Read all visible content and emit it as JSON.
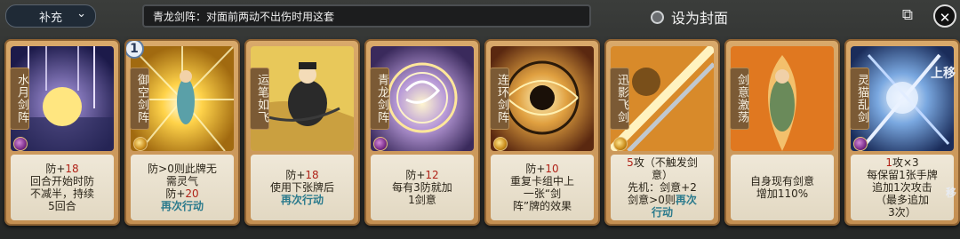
{
  "topbar": {
    "dropdown_label": "补充",
    "deck_name": "青龙剑阵：对面前两动不出伤时用这套",
    "cover_label": "设为封面"
  },
  "cards": [
    {
      "title": "水月剑阵",
      "gem": "purple",
      "lines": [
        {
          "t": "防+",
          "n": "18"
        },
        {
          "t": "回合开始时防"
        },
        {
          "t": "不减半，持续"
        },
        {
          "t": "5回合"
        }
      ]
    },
    {
      "title": "御空剑阵",
      "gem": "gold",
      "cost": "1",
      "lines": [
        {
          "t": "防>0则此牌无"
        },
        {
          "t": "需灵气"
        },
        {
          "t": "防+",
          "n": "20"
        },
        {
          "g": "再次行动"
        }
      ]
    },
    {
      "title": "运笔如飞",
      "gem": "none",
      "lines": [
        {
          "t": "防+",
          "n": "18"
        },
        {
          "t": "使用下张牌后"
        },
        {
          "g": "再次行动"
        }
      ]
    },
    {
      "title": "青龙剑阵",
      "gem": "purple",
      "lines": [
        {
          "t": "防+",
          "n": "12"
        },
        {
          "t": "每有3防就加"
        },
        {
          "t": "1剑意"
        }
      ]
    },
    {
      "title": "连环剑阵",
      "gem": "gold",
      "lines": [
        {
          "t": "防+",
          "n": "10"
        },
        {
          "t": "重复卡组中上"
        },
        {
          "t": "一张“剑"
        },
        {
          "t": "阵”牌的效果"
        }
      ]
    },
    {
      "title": "迅影飞剑",
      "gem": "gold",
      "lines": [
        {
          "n": "5",
          "t": "攻（不触发剑"
        },
        {
          "t": "意）"
        },
        {
          "t": "先机：剑意+2"
        },
        {
          "t": "剑意>0则",
          "g": "再次"
        },
        {
          "g": "行动"
        }
      ]
    },
    {
      "title": "剑意激荡",
      "gem": "none",
      "lines": [
        {
          "t": "自身现有剑意"
        },
        {
          "t": "增加110%"
        }
      ]
    },
    {
      "title": "灵猫乱剑",
      "gem": "purple",
      "up": "上移",
      "move": "移",
      "lines": [
        {
          "n": "1",
          "t": "攻×3"
        },
        {
          "t": "每保留1张手牌"
        },
        {
          "t": "追加1次攻击"
        },
        {
          "t": "（最多追加"
        },
        {
          "t": "3次）"
        }
      ]
    }
  ],
  "colors": {
    "number_red": "#b02218",
    "action_teal": "#2a7a8c"
  }
}
